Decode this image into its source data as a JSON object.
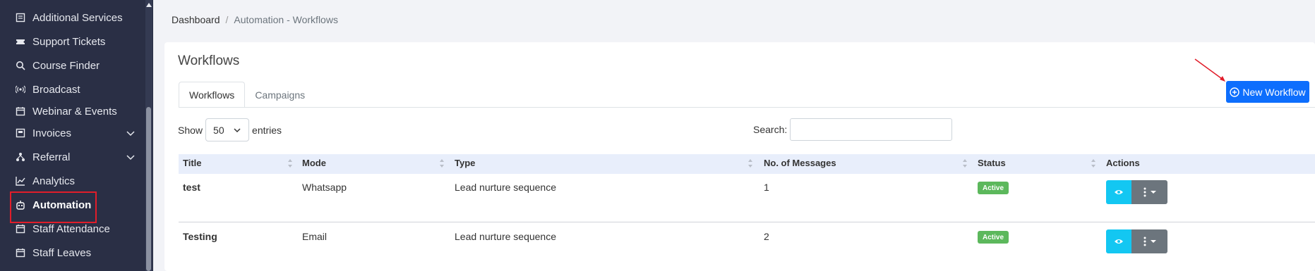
{
  "sidebar": {
    "items": [
      {
        "label": "Additional Services",
        "icon": "services-icon"
      },
      {
        "label": "Support Tickets",
        "icon": "ticket-icon"
      },
      {
        "label": "Course Finder",
        "icon": "search-icon"
      },
      {
        "label": "Broadcast",
        "icon": "broadcast-icon"
      },
      {
        "label": "Webinar & Events",
        "icon": "calendar-icon"
      },
      {
        "label": "Invoices",
        "icon": "invoice-icon"
      },
      {
        "label": "Referral",
        "icon": "referral-icon"
      },
      {
        "label": "Analytics",
        "icon": "chart-line-icon"
      },
      {
        "label": "Automation",
        "icon": "automation-icon"
      },
      {
        "label": "Staff Attendance",
        "icon": "calendar-icon"
      },
      {
        "label": "Staff Leaves",
        "icon": "calendar-icon"
      }
    ]
  },
  "breadcrumb": {
    "home": "Dashboard",
    "separator": "/",
    "current": "Automation - Workflows"
  },
  "page": {
    "title": "Workflows"
  },
  "tabs": [
    "Workflows",
    "Campaigns"
  ],
  "new_button": {
    "label": "New Workflow"
  },
  "length": {
    "show": "Show",
    "value": "50",
    "entries": "entries"
  },
  "search": {
    "label": "Search:",
    "value": ""
  },
  "table": {
    "headers": [
      "Title",
      "Mode",
      "Type",
      "No. of Messages",
      "Status",
      "Actions"
    ],
    "rows": [
      {
        "title": "test",
        "mode": "Whatsapp",
        "type": "Lead nurture sequence",
        "messages": "1",
        "status": "Active"
      },
      {
        "title": "Testing",
        "mode": "Email",
        "type": "Lead nurture sequence",
        "messages": "2",
        "status": "Active"
      }
    ]
  },
  "colors": {
    "sidebar_bg": "#2a2f45",
    "primary": "#0d6efd",
    "info": "#13c7f2",
    "secondary": "#6c757d",
    "success": "#5cb85c",
    "highlight_box": "#e11d2a"
  }
}
